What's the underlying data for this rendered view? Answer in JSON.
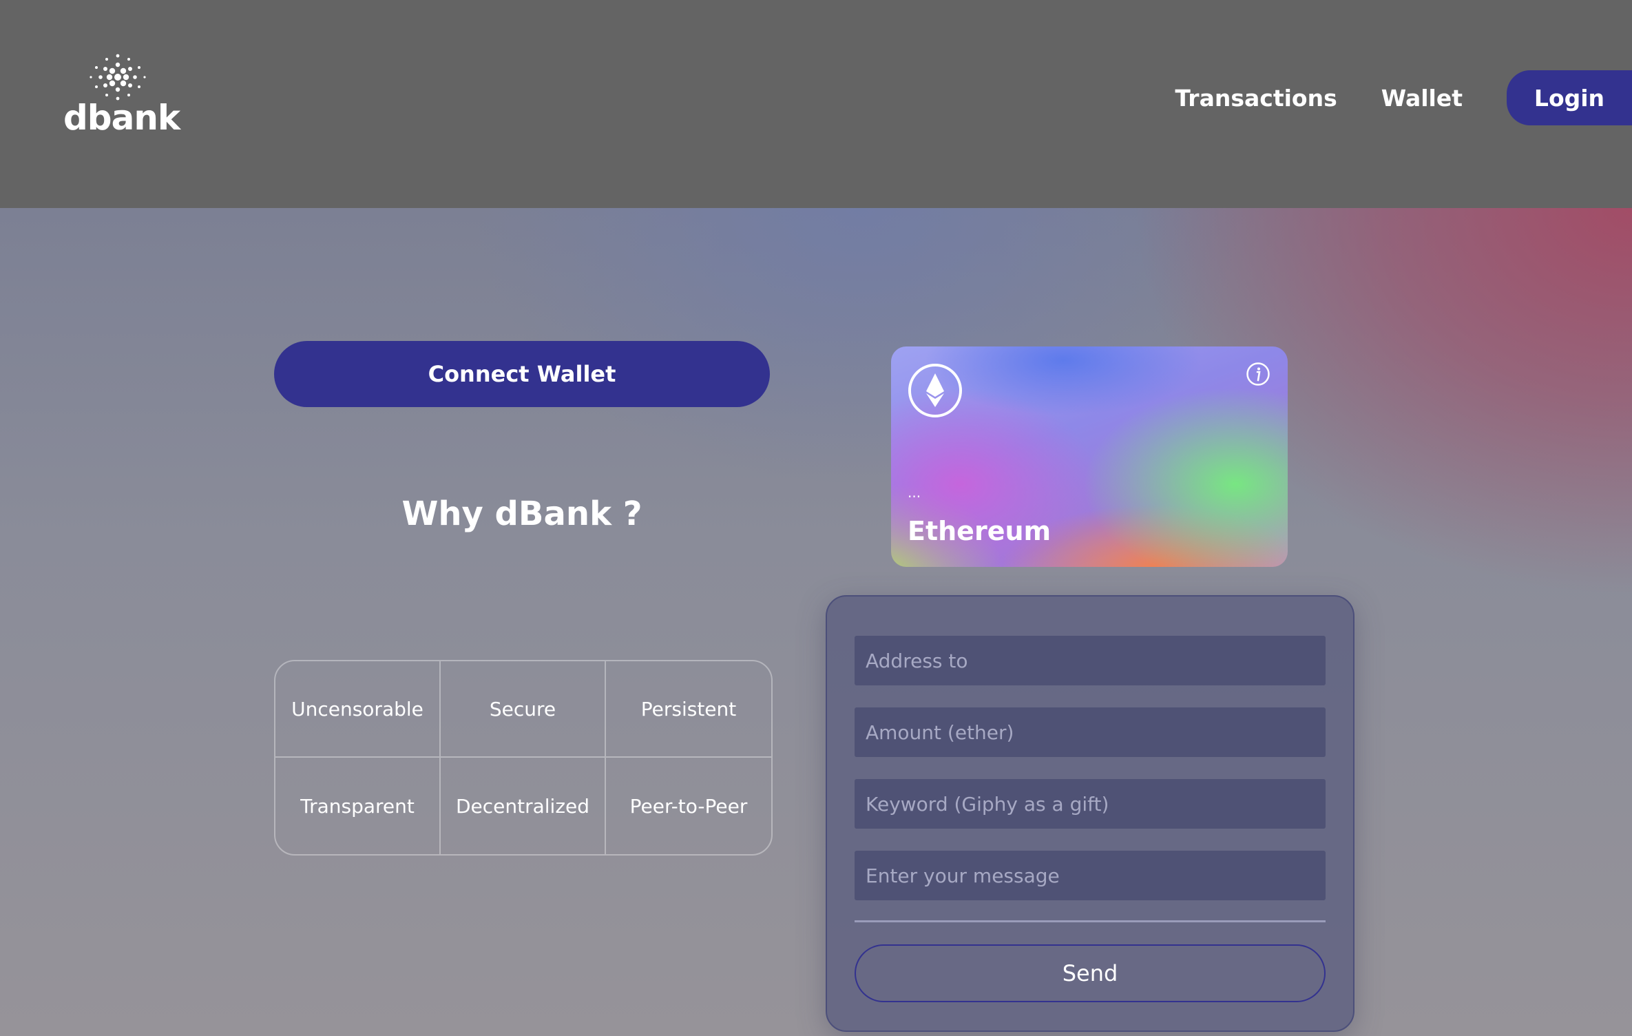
{
  "header": {
    "logo_text": "dbank",
    "nav": {
      "transactions": "Transactions",
      "wallet": "Wallet",
      "login": "Login"
    }
  },
  "hero": {
    "connect_button": "Connect Wallet",
    "why_title": "Why dBank ?",
    "features": [
      "Uncensorable",
      "Secure",
      "Persistent",
      "Transparent",
      "Decentralized",
      "Peer-to-Peer"
    ]
  },
  "eth_card": {
    "address": "...",
    "network": "Ethereum",
    "icons": {
      "logo": "ethereum-icon",
      "info": "info-icon"
    }
  },
  "form": {
    "address_placeholder": "Address to",
    "amount_placeholder": "Amount (ether)",
    "keyword_placeholder": "Keyword (Giphy as a gift)",
    "message_placeholder": "Enter your message",
    "send_label": "Send"
  },
  "colors": {
    "header_bg": "#646464",
    "accent": "#33328f",
    "field_bg": "#4f5275"
  }
}
